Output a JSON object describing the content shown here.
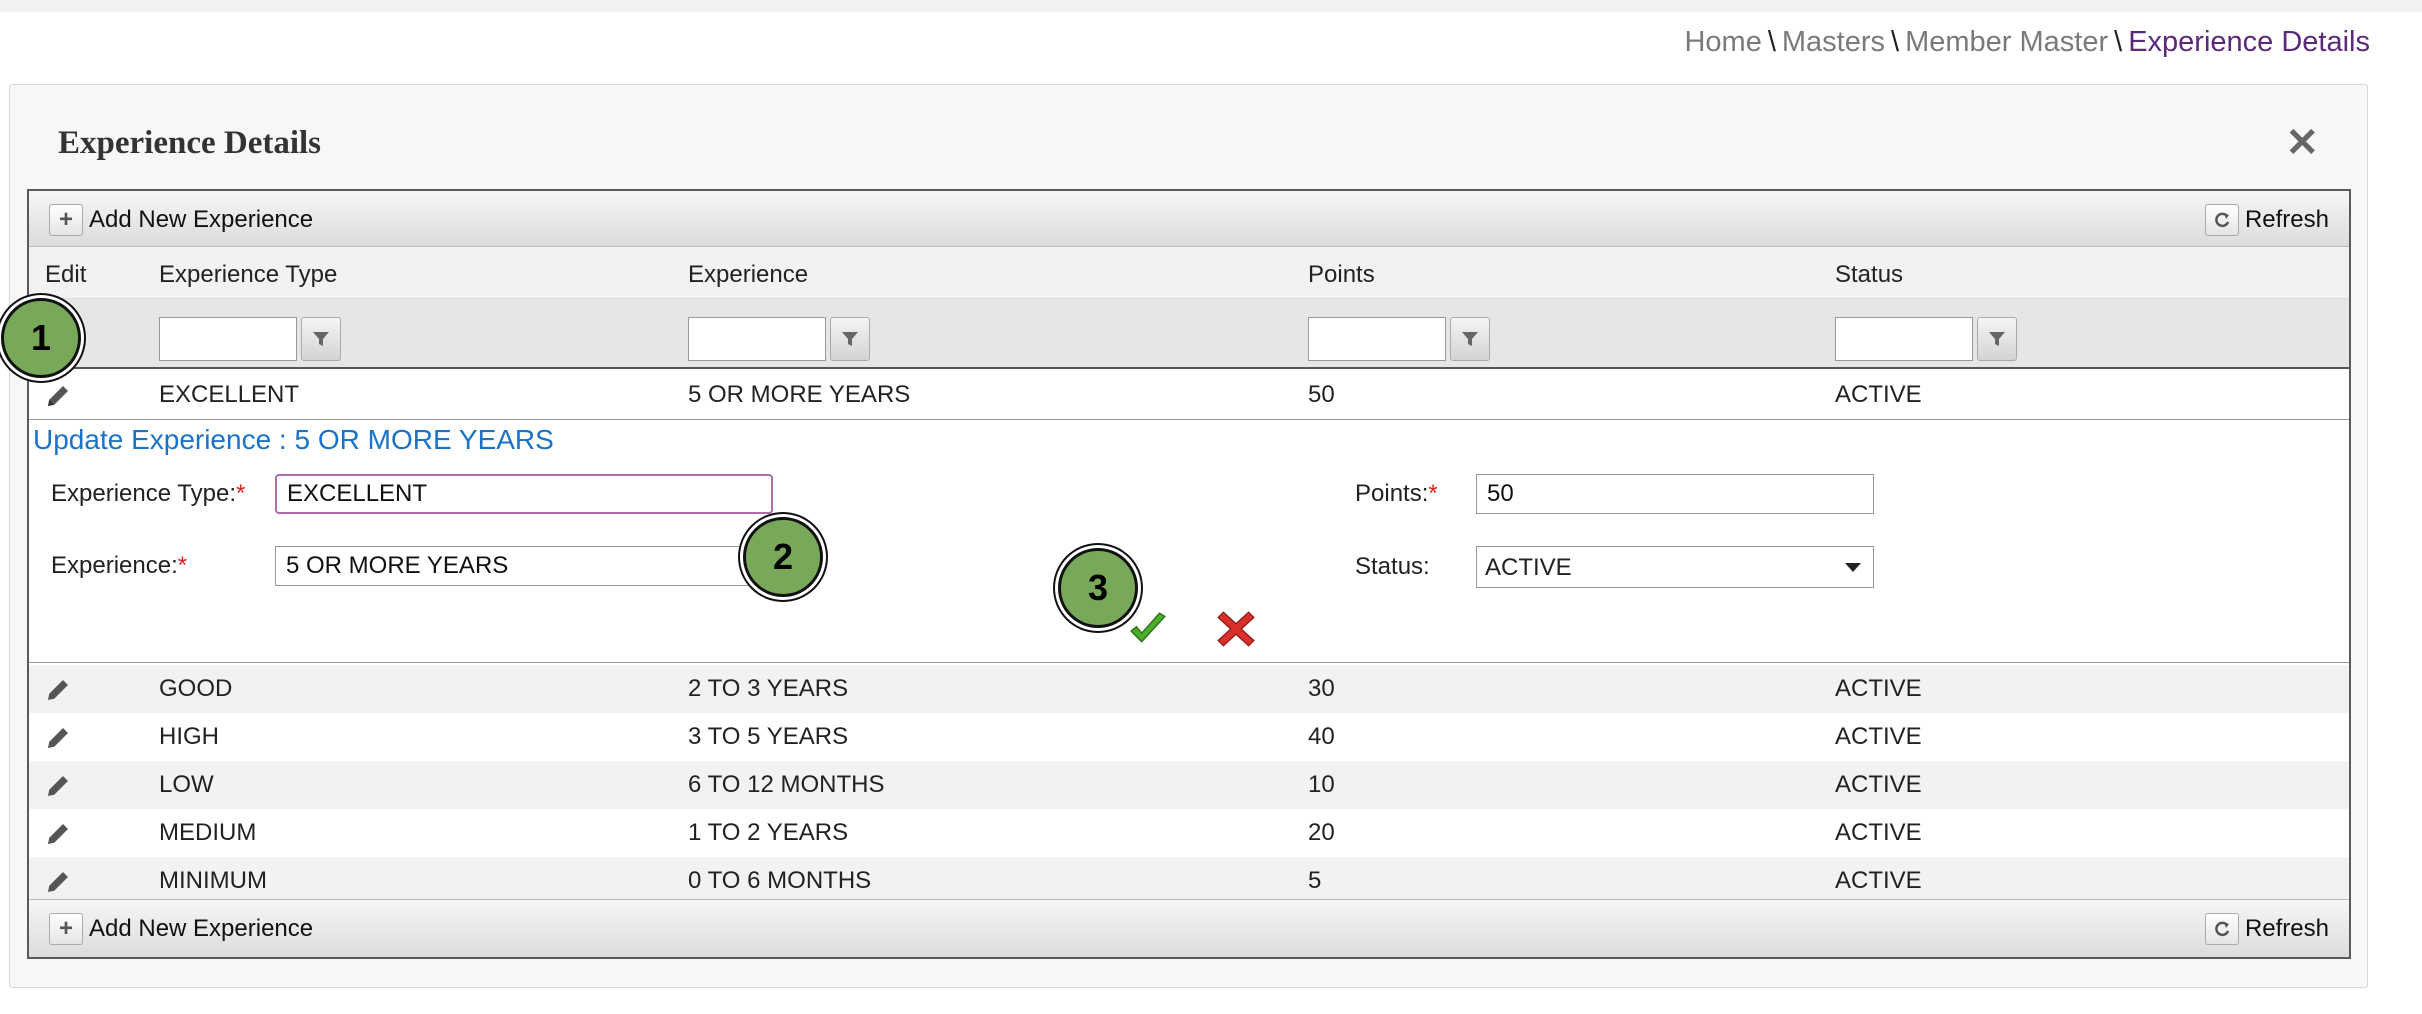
{
  "breadcrumb": {
    "items": [
      "Home",
      "Masters",
      "Member Master"
    ],
    "separator": "\\",
    "current": "Experience Details"
  },
  "panel": {
    "title": "Experience Details",
    "close_icon": "close-icon"
  },
  "toolbar": {
    "add_label": "Add New Experience",
    "refresh_label": "Refresh"
  },
  "columns": [
    "Edit",
    "Experience Type",
    "Experience",
    "Points",
    "Status"
  ],
  "editing_row": {
    "type": "EXCELLENT",
    "experience": "5 OR MORE YEARS",
    "points": "50",
    "status": "ACTIVE"
  },
  "edit_form": {
    "title": "Update Experience : 5 OR MORE YEARS",
    "experience_type_label": "Experience Type:",
    "experience_label": "Experience:",
    "points_label": "Points:",
    "status_label": "Status:",
    "required_mark": "*",
    "experience_type_value": "EXCELLENT",
    "experience_value": "5 OR MORE YEARS",
    "points_value": "50",
    "status_value": "ACTIVE"
  },
  "rows": [
    {
      "type": "GOOD",
      "experience": "2 TO 3 YEARS",
      "points": "30",
      "status": "ACTIVE"
    },
    {
      "type": "HIGH",
      "experience": "3 TO 5 YEARS",
      "points": "40",
      "status": "ACTIVE"
    },
    {
      "type": "LOW",
      "experience": "6 TO 12 MONTHS",
      "points": "10",
      "status": "ACTIVE"
    },
    {
      "type": "MEDIUM",
      "experience": "1 TO 2 YEARS",
      "points": "20",
      "status": "ACTIVE"
    },
    {
      "type": "MINIMUM",
      "experience": "0 TO 6 MONTHS",
      "points": "5",
      "status": "ACTIVE"
    }
  ],
  "markers": [
    "1",
    "2",
    "3"
  ],
  "colors": {
    "accent_purple": "#5a2a78",
    "form_title_blue": "#1a73c8",
    "marker_green": "#78a85a",
    "save_green": "#4cae2c",
    "cancel_red": "#d9302a"
  }
}
